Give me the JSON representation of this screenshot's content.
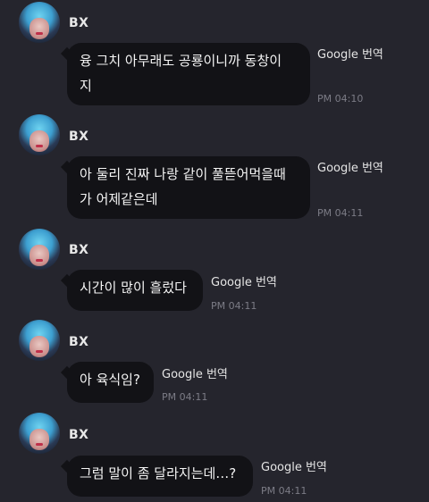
{
  "messages": [
    {
      "sender": "BX",
      "text": "융 그치 아무래도 공룡이니까 동창이\n지",
      "translate": "Google 번역",
      "time": "PM 04:10"
    },
    {
      "sender": "BX",
      "text": "아 둘리 진짜 나랑 같이 풀뜯어먹을때\n가 어제같은데",
      "translate": "Google 번역",
      "time": "PM 04:11"
    },
    {
      "sender": "BX",
      "text": "시간이 많이 흘렀다",
      "translate": "Google 번역",
      "time": "PM 04:11"
    },
    {
      "sender": "BX",
      "text": "아 육식임?",
      "translate": "Google 번역",
      "time": "PM 04:11"
    },
    {
      "sender": "BX",
      "text": "그럼 말이 좀 달라지는데…?",
      "translate": "Google 번역",
      "time": "PM 04:11"
    }
  ]
}
